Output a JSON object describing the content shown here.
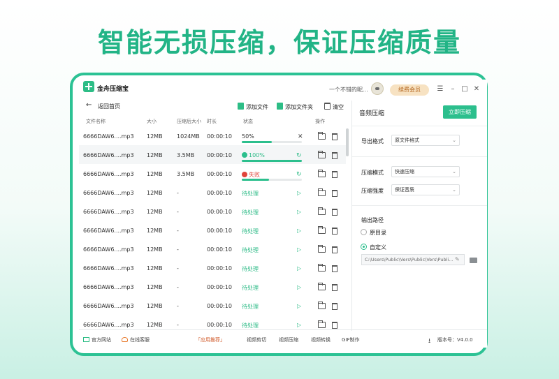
{
  "headline": "智能无损压缩，保证压缩质量",
  "app": {
    "title": "金舟压缩宝",
    "user_name": "一个不错的昵...",
    "vip_label": "续费会员"
  },
  "toolbar": {
    "back_label": "返回首页",
    "add_file": "添加文件",
    "add_folder": "添加文件夹",
    "clear": "清空"
  },
  "table": {
    "headers": {
      "name": "文件名称",
      "size": "大小",
      "compressed_size": "压缩后大小",
      "duration": "时长",
      "status": "状态",
      "actions": "操作"
    },
    "rows": [
      {
        "name": "6666DAW6....mp3",
        "size": "12MB",
        "compressed": "1024MB",
        "duration": "00:00:10",
        "status": "50%",
        "progress": 0.5
      },
      {
        "name": "6666DAW6....mp3",
        "size": "12MB",
        "compressed": "3.5MB",
        "duration": "00:00:10",
        "status": "100%",
        "progress": 1.0
      },
      {
        "name": "6666DAW6....mp3",
        "size": "12MB",
        "compressed": "3.5MB",
        "duration": "00:00:10",
        "status": "失败",
        "progress": 0.45
      },
      {
        "name": "6666DAW6....mp3",
        "size": "12MB",
        "compressed": "-",
        "duration": "00:00:10",
        "status": "待处理"
      },
      {
        "name": "6666DAW6....mp3",
        "size": "12MB",
        "compressed": "-",
        "duration": "00:00:10",
        "status": "待处理"
      },
      {
        "name": "6666DAW6....mp3",
        "size": "12MB",
        "compressed": "-",
        "duration": "00:00:10",
        "status": "待处理"
      },
      {
        "name": "6666DAW6....mp3",
        "size": "12MB",
        "compressed": "-",
        "duration": "00:00:10",
        "status": "待处理"
      },
      {
        "name": "6666DAW6....mp3",
        "size": "12MB",
        "compressed": "-",
        "duration": "00:00:10",
        "status": "待处理"
      },
      {
        "name": "6666DAW6....mp3",
        "size": "12MB",
        "compressed": "-",
        "duration": "00:00:10",
        "status": "待处理"
      },
      {
        "name": "6666DAW6....mp3",
        "size": "12MB",
        "compressed": "-",
        "duration": "00:00:10",
        "status": "待处理"
      },
      {
        "name": "6666DAW6....mp3",
        "size": "12MB",
        "compressed": "-",
        "duration": "00:00:10",
        "status": "待处理"
      }
    ]
  },
  "panel": {
    "title": "音频压缩",
    "compress_button": "立即压缩",
    "output_format_label": "导出格式",
    "output_format_value": "原文件格式",
    "mode_label": "压缩模式",
    "mode_value": "快速压缩",
    "strength_label": "压缩强度",
    "strength_value": "保证音质",
    "output_path_label": "输出路径",
    "option_original": "原目录",
    "option_custom": "自定义",
    "custom_path": "C:\\Users\\Public\\Vers\\Public\\Vers\\Publi..."
  },
  "footer": {
    "website": "官方网站",
    "support": "在线客服",
    "recommend": "「应用推荐」",
    "links": [
      "视频剪切",
      "视频压缩",
      "视频转换",
      "GIF制作"
    ],
    "version": "版本号：V4.0.0"
  },
  "colors": {
    "accent": "#2cbf8d",
    "headline": "#22b486",
    "error": "#e0443b",
    "vip_bg": "#f7e2c2"
  }
}
